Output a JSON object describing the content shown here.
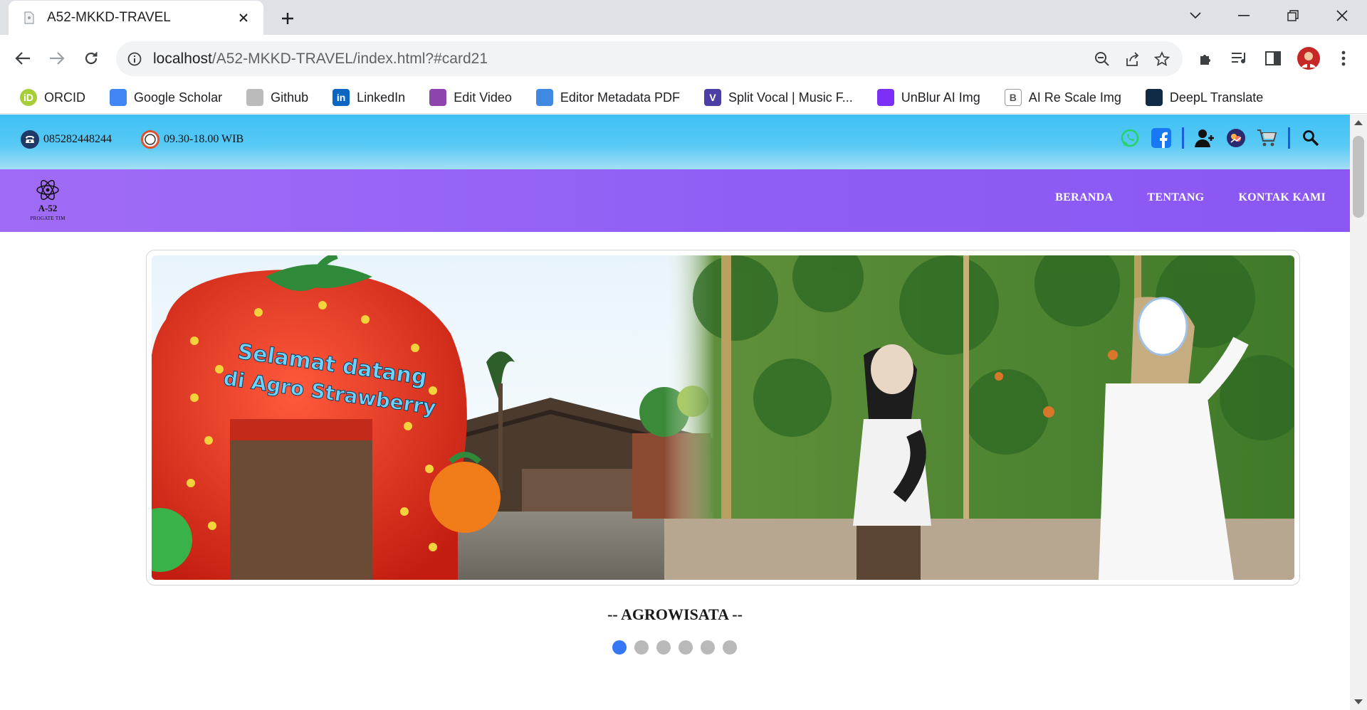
{
  "browser": {
    "tab": {
      "title": "A52-MKKD-TRAVEL",
      "favicon": "document-icon"
    },
    "url": {
      "host": "localhost",
      "path": "/A52-MKKD-TRAVEL/index.html?#card21"
    },
    "bookmarks": [
      {
        "label": "ORCID",
        "icon": "orcid-icon",
        "color": "#a6ce39",
        "glyph": "iD"
      },
      {
        "label": "Google Scholar",
        "icon": "scholar-icon",
        "color": "#4285f4",
        "glyph": ""
      },
      {
        "label": "Github",
        "icon": "github-icon",
        "color": "#bbbbbb",
        "glyph": ""
      },
      {
        "label": "LinkedIn",
        "icon": "linkedin-icon",
        "color": "#0a66c2",
        "glyph": "in"
      },
      {
        "label": "Edit Video",
        "icon": "clapper-icon",
        "color": "#8e44ad",
        "glyph": ""
      },
      {
        "label": "Editor Metadata PDF",
        "icon": "users-icon",
        "color": "#3f8ae0",
        "glyph": ""
      },
      {
        "label": "Split Vocal | Music F...",
        "icon": "v-logo-icon",
        "color": "#4b3fa6",
        "glyph": "V"
      },
      {
        "label": "UnBlur AI Img",
        "icon": "unblur-icon",
        "color": "#7b2ff7",
        "glyph": ""
      },
      {
        "label": "AI Re Scale Img",
        "icon": "b-logo-icon",
        "color": "#ffffff",
        "glyph": "B"
      },
      {
        "label": "DeepL Translate",
        "icon": "deepl-icon",
        "color": "#0f2b46",
        "glyph": ""
      }
    ]
  },
  "site": {
    "phone": "085282448244",
    "hours": "09.30-18.00 WIB",
    "logo": {
      "text": "A-52",
      "sub": "PROGATE TIM"
    },
    "nav": [
      "BERANDA",
      "TENTANG",
      "KONTAK KAMI"
    ],
    "top_icons": [
      "whatsapp-icon",
      "facebook-icon",
      "user-icon",
      "messenger-icon",
      "cart-icon",
      "search-icon"
    ],
    "carousel": {
      "sign_line1": "Selamat datang",
      "sign_line2": "di Agro Strawberry",
      "caption": "-- AGROWISATA --",
      "slides": 6,
      "active": 0
    }
  },
  "colors": {
    "topbar": "#3fc0f5",
    "navbar": "#8f5df5",
    "dot_active": "#3478f6",
    "dot_inactive": "#b9b9b9"
  }
}
